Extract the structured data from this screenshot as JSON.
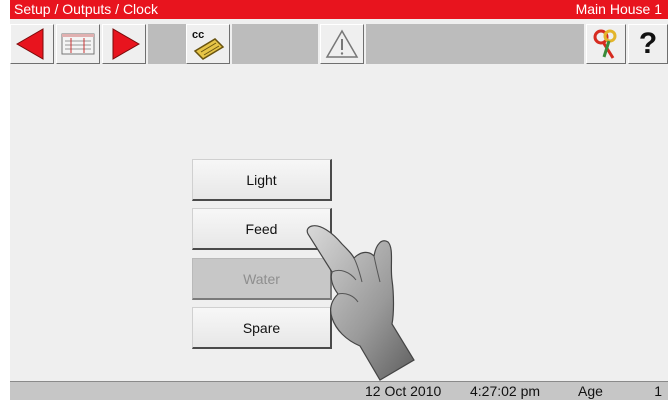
{
  "title_bar": {
    "breadcrumb": "Setup / Outputs / Clock",
    "location": "Main House 1"
  },
  "toolbar": {
    "prev_icon": "arrow-left-icon",
    "list_icon": "list-icon",
    "next_icon": "arrow-right-icon",
    "cc_icon": "cc-clipboard-icon",
    "cc_label": "cc",
    "warning_icon": "warning-icon",
    "keys_icon": "keys-icon",
    "help_label": "?"
  },
  "menu": {
    "items": [
      {
        "label": "Light",
        "enabled": true
      },
      {
        "label": "Feed",
        "enabled": true
      },
      {
        "label": "Water",
        "enabled": false
      },
      {
        "label": "Spare",
        "enabled": true
      }
    ]
  },
  "status_bar": {
    "date": "12 Oct 2010",
    "time": "4:27:02 pm",
    "age_label": "Age",
    "age_value": "1"
  },
  "colors": {
    "title_bar": "#e8141e",
    "arrow": "#e8141e",
    "background": "#efefef"
  }
}
